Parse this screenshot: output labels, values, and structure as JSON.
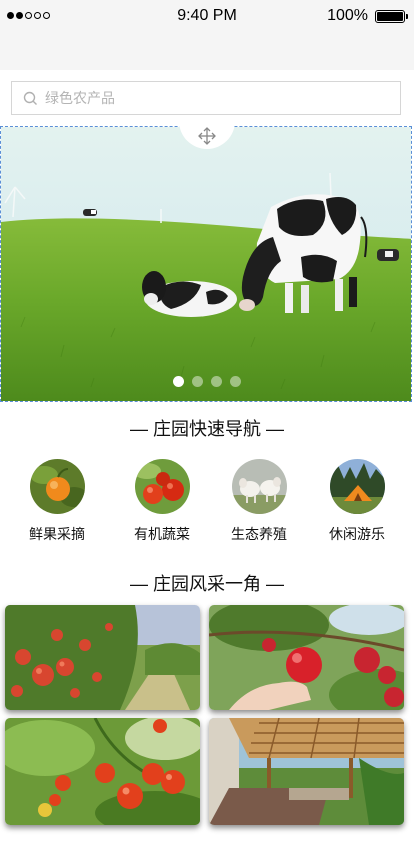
{
  "status_bar": {
    "time": "9:40 PM",
    "battery": "100%"
  },
  "search": {
    "placeholder": "绿色农产品",
    "value": ""
  },
  "banner": {
    "slide_count": 4,
    "active_index": 0
  },
  "quick_nav": {
    "title": "— 庄园快速导航 —",
    "items": [
      {
        "label": "鲜果采摘",
        "icon": "orange-fruit-image"
      },
      {
        "label": "有机蔬菜",
        "icon": "tomatoes-image"
      },
      {
        "label": "生态养殖",
        "icon": "lambs-image"
      },
      {
        "label": "休闲游乐",
        "icon": "camping-tent-image"
      }
    ]
  },
  "gallery": {
    "title": "— 庄园风采一角 —",
    "photos": [
      {
        "subject": "apple-orchard-photo"
      },
      {
        "subject": "apple-picking-photo"
      },
      {
        "subject": "cherry-tomatoes-photo"
      },
      {
        "subject": "wooden-pergola-photo"
      }
    ]
  },
  "colors": {
    "accent_border": "#5a8fd6",
    "grass": "#6aa82a",
    "sky": "#d6ecf4"
  }
}
